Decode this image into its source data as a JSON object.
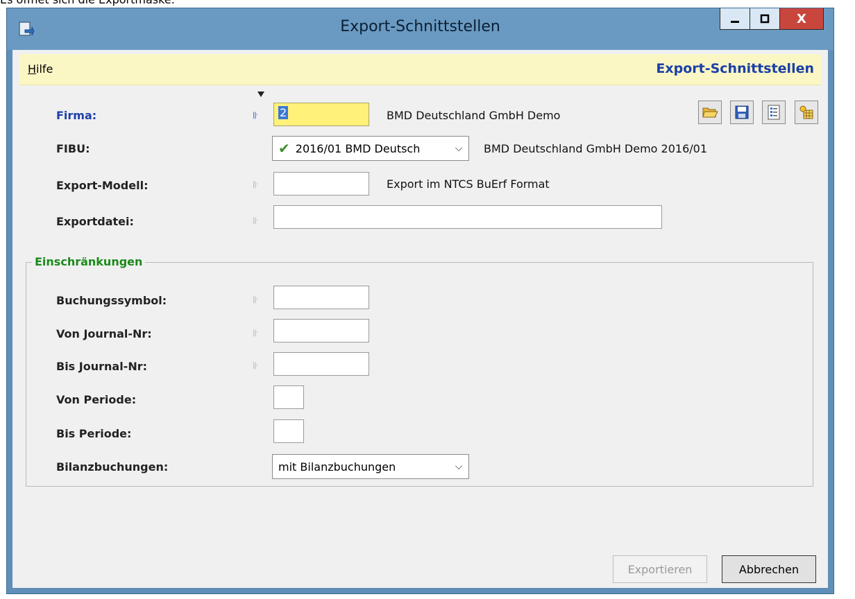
{
  "caption": "Es öffnet sich die Exportmaske:",
  "window": {
    "title": "Export-Schnittstellen",
    "minimize_label": "_",
    "maximize_label": "□",
    "close_label": "X"
  },
  "menu": {
    "hilfe_first": "H",
    "hilfe_rest": "ilfe",
    "title": "Export-Schnittstellen"
  },
  "form": {
    "firma": {
      "label": "Firma:",
      "value": "2",
      "desc": "BMD Deutschland GmbH Demo"
    },
    "fibu": {
      "label": "FIBU:",
      "selected": "2016/01 BMD Deutsch",
      "desc": "BMD Deutschland GmbH Demo 2016/01"
    },
    "export_modell": {
      "label": "Export-Modell:",
      "value": "",
      "desc": "Export im NTCS BuErf Format"
    },
    "exportdatei": {
      "label": "Exportdatei:",
      "value": ""
    }
  },
  "toolbar": {
    "icons": [
      "open-folder-icon",
      "save-icon",
      "list-icon",
      "settings-grid-icon"
    ]
  },
  "einschraenkungen": {
    "legend": "Einschränkungen",
    "buchungssymbol": {
      "label": "Buchungssymbol:",
      "value": ""
    },
    "von_journal": {
      "label": "Von Journal-Nr:",
      "value": ""
    },
    "bis_journal": {
      "label": "Bis Journal-Nr:",
      "value": ""
    },
    "von_periode": {
      "label": "Von Periode:",
      "value": ""
    },
    "bis_periode": {
      "label": "Bis Periode:",
      "value": ""
    },
    "bilanzbuchungen": {
      "label": "Bilanzbuchungen:",
      "selected": "mit Bilanzbuchungen"
    }
  },
  "buttons": {
    "export": "Exportieren",
    "cancel": "Abbrechen"
  },
  "colors": {
    "menubar_bg": "#fbf7c5",
    "title_blue": "#1b3fa6",
    "group_green": "#1a8a1a",
    "close_red": "#c9463d"
  }
}
